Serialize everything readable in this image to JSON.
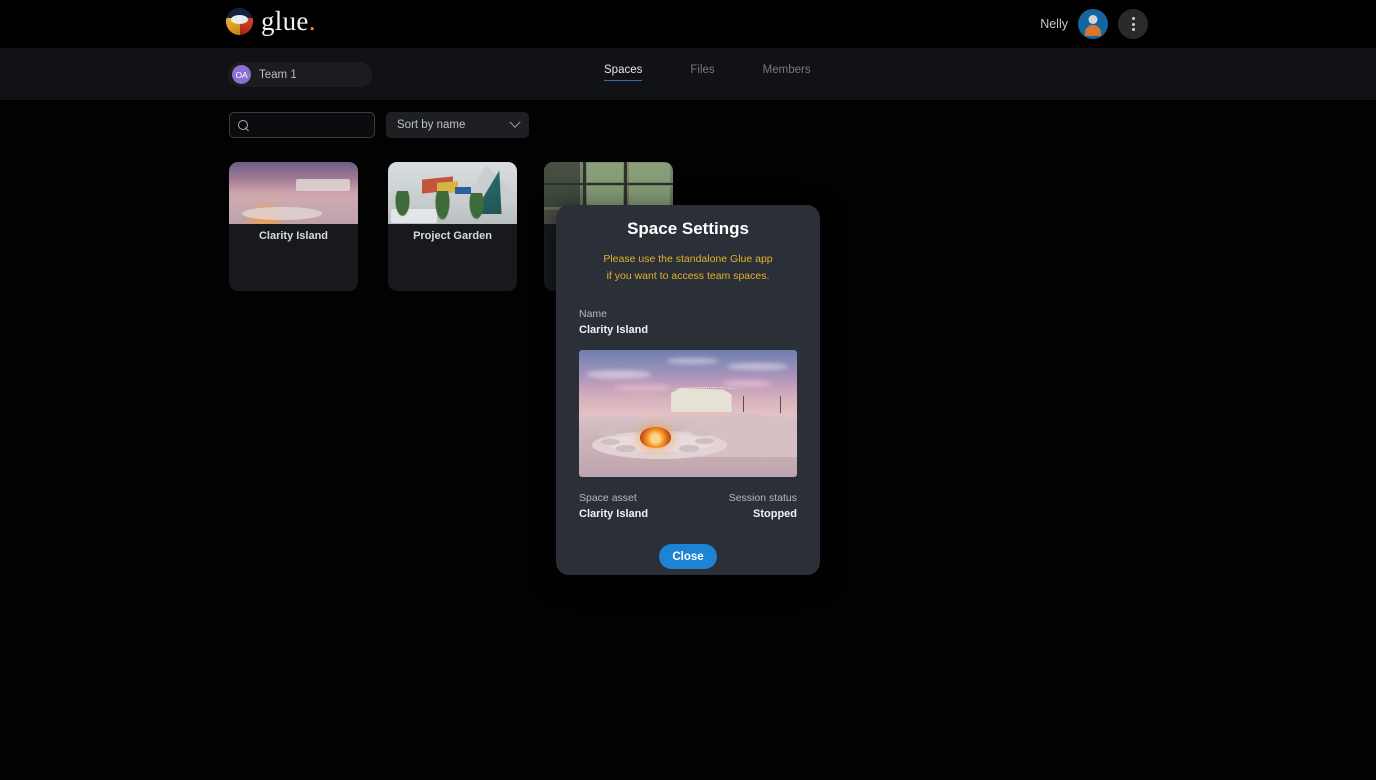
{
  "app": {
    "brand_name": "glue",
    "brand_dot": "."
  },
  "topbar": {
    "user_name": "Nelly",
    "avatar_icon": "user-avatar-icon",
    "menu_icon": "kebab-menu-icon"
  },
  "team": {
    "avatar_initials": "OA",
    "name": "Team 1"
  },
  "tabs": [
    {
      "label": "Spaces",
      "active": true
    },
    {
      "label": "Files",
      "active": false
    },
    {
      "label": "Members",
      "active": false
    }
  ],
  "controls": {
    "search_value": "",
    "search_placeholder": "",
    "search_icon": "search-icon",
    "sort_label": "Sort by name",
    "sort_chevron": "chevron-down-icon"
  },
  "spaces": [
    {
      "title": "Clarity Island"
    },
    {
      "title": "Project Garden"
    },
    {
      "title": ""
    }
  ],
  "modal": {
    "title": "Space Settings",
    "warning_line1": "Please use the standalone Glue app",
    "warning_line2": "if you want to access team spaces.",
    "name_label": "Name",
    "name_value": "Clarity Island",
    "asset_label": "Space asset",
    "asset_value": "Clarity Island",
    "status_label": "Session status",
    "status_value": "Stopped",
    "close_label": "Close"
  },
  "colors": {
    "page_background": "#020203",
    "subbar_background": "#111216",
    "card_background": "#17191c",
    "modal_background": "#2b3038",
    "accent_blue": "#1d83d4",
    "tab_underline": "#2f6fb4",
    "warning_yellow": "#e0b22a",
    "team_avatar_purple": "#8d6fd1",
    "brand_dot_orange": "#e6921f"
  }
}
